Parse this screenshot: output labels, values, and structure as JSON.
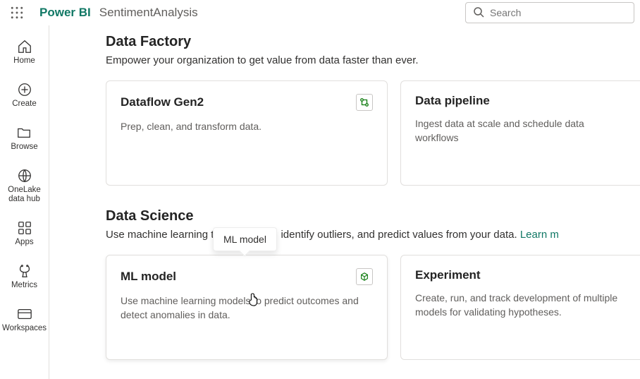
{
  "header": {
    "brand": "Power BI",
    "workspace": "SentimentAnalysis",
    "search_placeholder": "Search"
  },
  "nav": {
    "home": "Home",
    "create": "Create",
    "browse": "Browse",
    "onelake": "OneLake data hub",
    "apps": "Apps",
    "metrics": "Metrics",
    "workspaces": "Workspaces"
  },
  "sections": [
    {
      "title": "Data Factory",
      "subtitle": "Empower your organization to get value from data faster than ever.",
      "cards": [
        {
          "title": "Dataflow Gen2",
          "desc": "Prep, clean, and transform data."
        },
        {
          "title": "Data pipeline",
          "desc": "Ingest data at scale and schedule data workflows"
        }
      ]
    },
    {
      "title": "Data Science",
      "subtitle": "Use machine learning to spot trends, identify outliers, and predict values from your data. ",
      "learn_more": "Learn m",
      "cards": [
        {
          "title": "ML model",
          "desc": "Use machine learning models to predict outcomes and detect anomalies in data."
        },
        {
          "title": "Experiment",
          "desc": "Create, run, and track development of multiple models for validating hypotheses."
        }
      ]
    }
  ],
  "tooltip": "ML model"
}
